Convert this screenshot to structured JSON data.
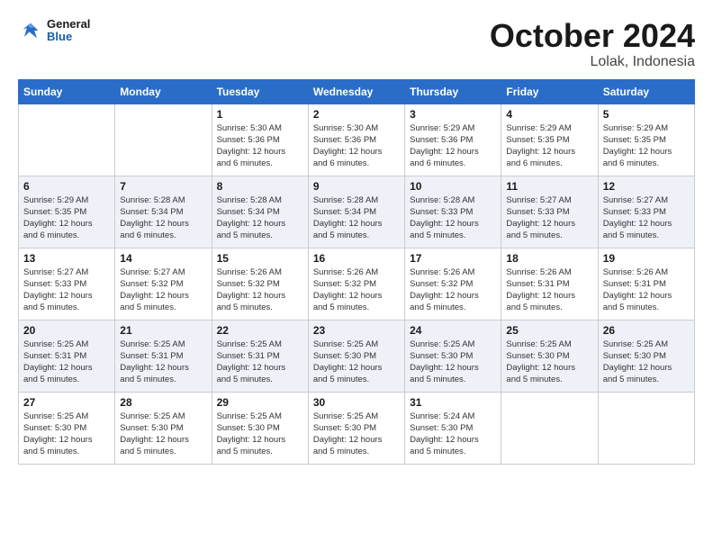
{
  "header": {
    "logo_general": "General",
    "logo_blue": "Blue",
    "month_title": "October 2024",
    "location": "Lolak, Indonesia"
  },
  "days_of_week": [
    "Sunday",
    "Monday",
    "Tuesday",
    "Wednesday",
    "Thursday",
    "Friday",
    "Saturday"
  ],
  "weeks": [
    [
      {
        "day": "",
        "info": ""
      },
      {
        "day": "",
        "info": ""
      },
      {
        "day": "1",
        "info": "Sunrise: 5:30 AM\nSunset: 5:36 PM\nDaylight: 12 hours\nand 6 minutes."
      },
      {
        "day": "2",
        "info": "Sunrise: 5:30 AM\nSunset: 5:36 PM\nDaylight: 12 hours\nand 6 minutes."
      },
      {
        "day": "3",
        "info": "Sunrise: 5:29 AM\nSunset: 5:36 PM\nDaylight: 12 hours\nand 6 minutes."
      },
      {
        "day": "4",
        "info": "Sunrise: 5:29 AM\nSunset: 5:35 PM\nDaylight: 12 hours\nand 6 minutes."
      },
      {
        "day": "5",
        "info": "Sunrise: 5:29 AM\nSunset: 5:35 PM\nDaylight: 12 hours\nand 6 minutes."
      }
    ],
    [
      {
        "day": "6",
        "info": "Sunrise: 5:29 AM\nSunset: 5:35 PM\nDaylight: 12 hours\nand 6 minutes."
      },
      {
        "day": "7",
        "info": "Sunrise: 5:28 AM\nSunset: 5:34 PM\nDaylight: 12 hours\nand 6 minutes."
      },
      {
        "day": "8",
        "info": "Sunrise: 5:28 AM\nSunset: 5:34 PM\nDaylight: 12 hours\nand 5 minutes."
      },
      {
        "day": "9",
        "info": "Sunrise: 5:28 AM\nSunset: 5:34 PM\nDaylight: 12 hours\nand 5 minutes."
      },
      {
        "day": "10",
        "info": "Sunrise: 5:28 AM\nSunset: 5:33 PM\nDaylight: 12 hours\nand 5 minutes."
      },
      {
        "day": "11",
        "info": "Sunrise: 5:27 AM\nSunset: 5:33 PM\nDaylight: 12 hours\nand 5 minutes."
      },
      {
        "day": "12",
        "info": "Sunrise: 5:27 AM\nSunset: 5:33 PM\nDaylight: 12 hours\nand 5 minutes."
      }
    ],
    [
      {
        "day": "13",
        "info": "Sunrise: 5:27 AM\nSunset: 5:33 PM\nDaylight: 12 hours\nand 5 minutes."
      },
      {
        "day": "14",
        "info": "Sunrise: 5:27 AM\nSunset: 5:32 PM\nDaylight: 12 hours\nand 5 minutes."
      },
      {
        "day": "15",
        "info": "Sunrise: 5:26 AM\nSunset: 5:32 PM\nDaylight: 12 hours\nand 5 minutes."
      },
      {
        "day": "16",
        "info": "Sunrise: 5:26 AM\nSunset: 5:32 PM\nDaylight: 12 hours\nand 5 minutes."
      },
      {
        "day": "17",
        "info": "Sunrise: 5:26 AM\nSunset: 5:32 PM\nDaylight: 12 hours\nand 5 minutes."
      },
      {
        "day": "18",
        "info": "Sunrise: 5:26 AM\nSunset: 5:31 PM\nDaylight: 12 hours\nand 5 minutes."
      },
      {
        "day": "19",
        "info": "Sunrise: 5:26 AM\nSunset: 5:31 PM\nDaylight: 12 hours\nand 5 minutes."
      }
    ],
    [
      {
        "day": "20",
        "info": "Sunrise: 5:25 AM\nSunset: 5:31 PM\nDaylight: 12 hours\nand 5 minutes."
      },
      {
        "day": "21",
        "info": "Sunrise: 5:25 AM\nSunset: 5:31 PM\nDaylight: 12 hours\nand 5 minutes."
      },
      {
        "day": "22",
        "info": "Sunrise: 5:25 AM\nSunset: 5:31 PM\nDaylight: 12 hours\nand 5 minutes."
      },
      {
        "day": "23",
        "info": "Sunrise: 5:25 AM\nSunset: 5:30 PM\nDaylight: 12 hours\nand 5 minutes."
      },
      {
        "day": "24",
        "info": "Sunrise: 5:25 AM\nSunset: 5:30 PM\nDaylight: 12 hours\nand 5 minutes."
      },
      {
        "day": "25",
        "info": "Sunrise: 5:25 AM\nSunset: 5:30 PM\nDaylight: 12 hours\nand 5 minutes."
      },
      {
        "day": "26",
        "info": "Sunrise: 5:25 AM\nSunset: 5:30 PM\nDaylight: 12 hours\nand 5 minutes."
      }
    ],
    [
      {
        "day": "27",
        "info": "Sunrise: 5:25 AM\nSunset: 5:30 PM\nDaylight: 12 hours\nand 5 minutes."
      },
      {
        "day": "28",
        "info": "Sunrise: 5:25 AM\nSunset: 5:30 PM\nDaylight: 12 hours\nand 5 minutes."
      },
      {
        "day": "29",
        "info": "Sunrise: 5:25 AM\nSunset: 5:30 PM\nDaylight: 12 hours\nand 5 minutes."
      },
      {
        "day": "30",
        "info": "Sunrise: 5:25 AM\nSunset: 5:30 PM\nDaylight: 12 hours\nand 5 minutes."
      },
      {
        "day": "31",
        "info": "Sunrise: 5:24 AM\nSunset: 5:30 PM\nDaylight: 12 hours\nand 5 minutes."
      },
      {
        "day": "",
        "info": ""
      },
      {
        "day": "",
        "info": ""
      }
    ]
  ]
}
